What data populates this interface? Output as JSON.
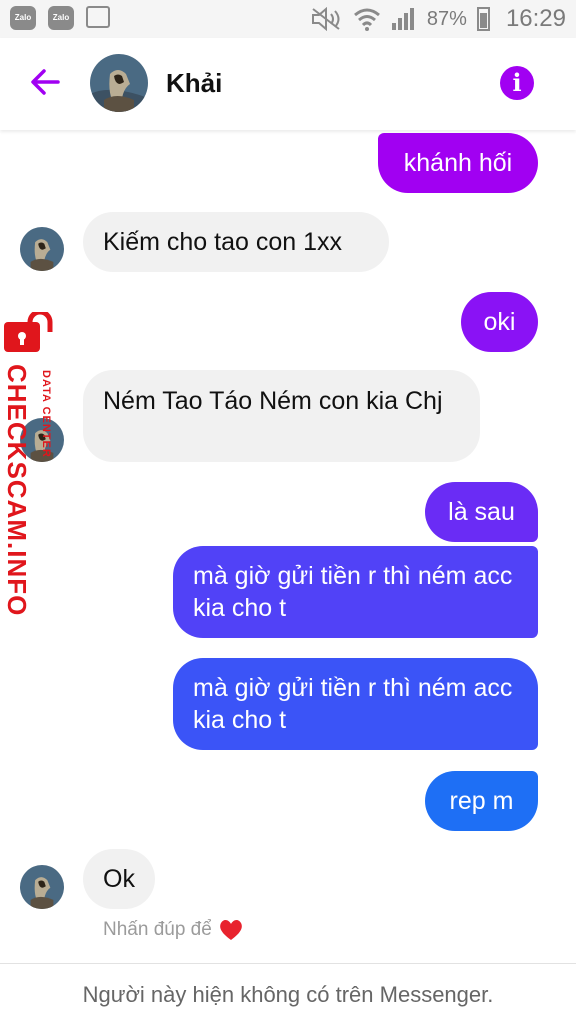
{
  "status_bar": {
    "apps": [
      "Zalo",
      "Zalo"
    ],
    "battery": "87%",
    "time": "16:29"
  },
  "header": {
    "back_icon": "back-arrow-icon",
    "contact_name": "Khải",
    "info_icon": "info-icon",
    "info_glyph": "i",
    "accent_color": "#a100f2"
  },
  "messages": [
    {
      "dir": "out",
      "text": "khánh hối",
      "color": "#a100f2"
    },
    {
      "dir": "in",
      "text": "Kiếm cho tao con 1xx"
    },
    {
      "dir": "out",
      "text": "oki",
      "color": "#8a12f5"
    },
    {
      "dir": "in",
      "text": "Ném Tao Táo Ném con kia Chj"
    },
    {
      "dir": "out",
      "text": "là sau",
      "color": "#6a2cf5"
    },
    {
      "dir": "out",
      "text": "mà giờ gửi tiền r thì ném acc kia cho t",
      "color": "#5142f7"
    },
    {
      "dir": "out",
      "text": "mà giờ gửi tiền r thì ném acc kia cho t",
      "color": "#3b54f7"
    },
    {
      "dir": "out",
      "text": "rep m",
      "color": "#1e6ff5"
    },
    {
      "dir": "in",
      "text": "Ok"
    }
  ],
  "tap_hint": "Nhấn đúp để",
  "heart_icon": "heart-icon",
  "footer_note": "Người này hiện không có trên Messenger.",
  "watermark": {
    "main": "CHECKSCAM.INFO",
    "sub": "DATA CENTER",
    "color": "#e0161c"
  }
}
